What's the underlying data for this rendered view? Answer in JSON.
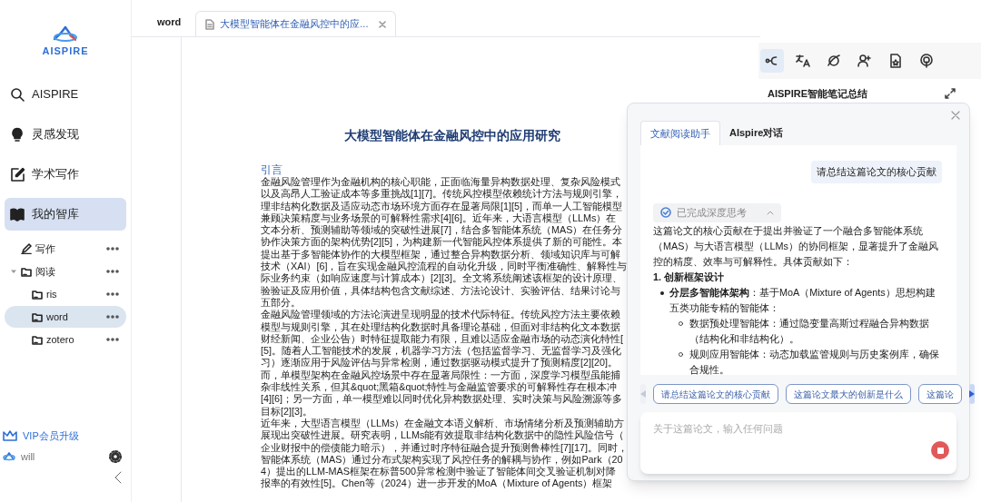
{
  "sidebar": {
    "logo_text": "AISPIRE",
    "nav": [
      {
        "kind": "search",
        "label": "AISPIRE",
        "selected": false
      },
      {
        "kind": "bulb",
        "label": "灵感发现",
        "selected": false
      },
      {
        "kind": "edit",
        "label": "学术写作",
        "selected": false
      },
      {
        "kind": "book",
        "label": "我的智库",
        "selected": true
      }
    ],
    "tree": [
      {
        "kind": "pen",
        "label": "写作",
        "selected": false
      },
      {
        "kind": "folder",
        "label": "阅读",
        "selected": false,
        "expanded": true,
        "children": [
          {
            "kind": "folder",
            "label": "ris",
            "selected": false
          },
          {
            "kind": "folder",
            "label": "word",
            "selected": true
          },
          {
            "kind": "folder",
            "label": "zotero",
            "selected": false
          }
        ]
      }
    ],
    "vip": "VIP会员升级",
    "user": "will"
  },
  "tabs": {
    "breadcrumb": "word",
    "items": [
      {
        "title": "大模型智能体在金融风控中的应...",
        "selected": true
      }
    ]
  },
  "document": {
    "title": "大模型智能体在金融风控中的应用研究",
    "heading": "引言",
    "lines": [
      "金融风险管理作为金融机构的核心职能，正面临海量异构数据处理、复杂风险模式",
      "以及高昂人工验证成本等多重挑战[1][7]。传统风控模型依赖统计方法与规则引擎，",
      "理非结构化数据及适应动态市场环境方面存在显著局限[1][5]，而单一人工智能模型",
      "兼顾决策精度与业务场景的可解释性需求[4][6]。近年来，大语言模型（LLMs）在",
      "文本分析、预测辅助等领域的突破性进展[7]，结合多智能体系统（MAS）在任务分",
      "协作决策方面的架构优势[2][5]，为构建新一代智能风控体系提供了新的可能性。本",
      "提出基于多智能体协作的大模型框架，通过整合异构数据分析、领域知识库与可解",
      "技术（XAI）[6]，旨在实现金融风控流程的自动化升级，同时平衡准确性、解释性与",
      "际业务约束（如响应速度与计算成本）[2][3]。全文将系统阐述该框架的设计原理、",
      "验验证及应用价值，具体结构包含文献综述、方法论设计、实验评估、结果讨论与",
      "五部分。",
      "金融风险管理领域的方法论演进呈现明显的技术代际特征。传统风控方法主要依赖",
      "模型与规则引擎，其在处理结构化数据时具备理论基础，但面对非结构化文本数据",
      "财经新闻、企业公告）时特征提取能力有限，且难以适应金融市场的动态演化特性[",
      "[5]。随着人工智能技术的发展，机器学习方法（包括监督学习、无监督学习及强化",
      "习）逐渐应用于风险评估与异常检测，通过数据驱动模式提升了预测精度[2][20]。",
      "而，单模型架构在金融风控场景中存在显著局限性：一方面，深度学习模型虽能捕",
      "杂非线性关系，但其&quot;黑箱&quot;特性与金融监管要求的可解释性存在根本冲",
      "[4][6]；另一方面，单一模型难以同时优化异构数据处理、实时决策与风险溯源等多",
      "目标[2][3]。",
      "近年来，大型语言模型（LLMs）在金融文本语义解析、市场情绪分析及预测辅助方",
      "展现出突破性进展。研究表明，LLMs能有效提取非结构化数据中的隐性风险信号（",
      "企业财报中的偿债能力暗示），并通过时序特征融合提升预测鲁棒性[7][17]。同时，",
      "智能体系统（MAS）通过分布式架构实现了风控任务的解耦与协作，例如Park（20",
      "4）提出的LLM-MAS框架在标普500异常检测中验证了智能体间交叉验证机制对降",
      "报率的有效性[5]。Chen等（2024）进一步开发的MoA（Mixture of Agents）框架"
    ]
  },
  "notes_panel": {
    "tools": [
      {
        "selected": true
      },
      {
        "selected": false
      },
      {
        "selected": false
      },
      {
        "selected": false
      },
      {
        "selected": false
      },
      {
        "selected": false
      }
    ],
    "title": "AISPIRE智能笔记总结"
  },
  "assistant": {
    "tabs": [
      {
        "label": "文献阅读助手",
        "selected": true
      },
      {
        "label": "AIspire对话",
        "selected": false
      }
    ],
    "user_message": "请总结这篇论文的核心贡献",
    "thinking": {
      "label": "已完成深度思考",
      "expanded": true
    },
    "answer": {
      "intro": "这篇论文的核心贡献在于提出并验证了一个融合多智能体系统（MAS）与大语言模型（LLMs）的协同框架，显著提升了金融风控的精度、效率与可解释性。具体贡献如下：",
      "sections": [
        {
          "heading": "1. 创新框架设计",
          "bullets": [
            {
              "text": "**分层多智能体架构**：基于MoA（Mixture of Agents）思想构建五类功能专精的智能体：",
              "children": [
                {
                  "text": "数据预处理智能体：通过隐变量高斯过程融合异构数据（结构化和非结构化）。"
                },
                {
                  "text": "规则应用智能体：动态加载监管规则与历史案例库，确保合规性。"
                }
              ]
            }
          ]
        }
      ]
    },
    "suggestions": [
      "请总结这篇论文的核心贡献",
      "这篇论文最大的创新是什么",
      "这篇论"
    ],
    "scroll_left": {
      "disabled": true
    },
    "scroll_right": {
      "disabled": false
    },
    "input": {
      "placeholder": "关于这篇论文，输入任何问题"
    }
  }
}
